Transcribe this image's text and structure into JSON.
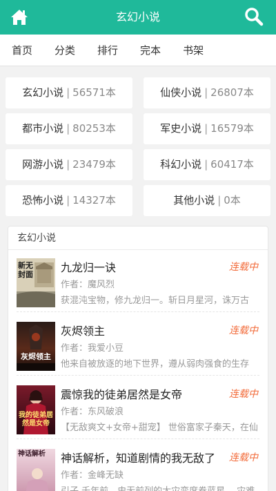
{
  "header": {
    "title": "玄幻小说",
    "home_icon": "home-icon",
    "search_icon": "search-icon",
    "color": "#1fb99a"
  },
  "nav": {
    "items": [
      "首页",
      "分类",
      "排行",
      "完本",
      "书架"
    ]
  },
  "categories": [
    {
      "name": "玄幻小说",
      "count": "56571本"
    },
    {
      "name": "仙侠小说",
      "count": "26807本"
    },
    {
      "name": "都市小说",
      "count": "80253本"
    },
    {
      "name": "军史小说",
      "count": "16579本"
    },
    {
      "name": "网游小说",
      "count": "23479本"
    },
    {
      "name": "科幻小说",
      "count": "60417本"
    },
    {
      "name": "恐怖小说",
      "count": "14327本"
    },
    {
      "name": "其他小说",
      "count": "0本"
    }
  ],
  "section": {
    "title": "玄幻小说",
    "books": [
      {
        "title": "九龙归一诀",
        "status": "连载中",
        "author": "作者：魔风烈",
        "desc": "获混沌宝物，修九龙归一。斩日月星河，诛万古",
        "cover_text": "新无封面"
      },
      {
        "title": "灰烬领主",
        "status": "连载中",
        "author": "作者：我爱小豆",
        "desc": "他来自被放逐的地下世界，遵从弱肉强食的生存",
        "cover_text": "灰烬领主"
      },
      {
        "title": "震惊我的徒弟居然是女帝",
        "status": "连载中",
        "author": "作者：东风破浪",
        "desc": "【无敌爽文+女帝+甜宠】 世俗富家子秦天，在仙",
        "cover_text": "我的徒弟居然是女帝"
      },
      {
        "title": "神话解析，知道剧情的我无敌了",
        "status": "连载中",
        "author": "作者：金峰无缺",
        "desc": "引子 千年前，史无前列的大灾变席卷蓝星。 灾难",
        "cover_text": "神话解析"
      }
    ]
  },
  "colors": {
    "accent": "#1fb99a",
    "status": "#f26b3a"
  }
}
